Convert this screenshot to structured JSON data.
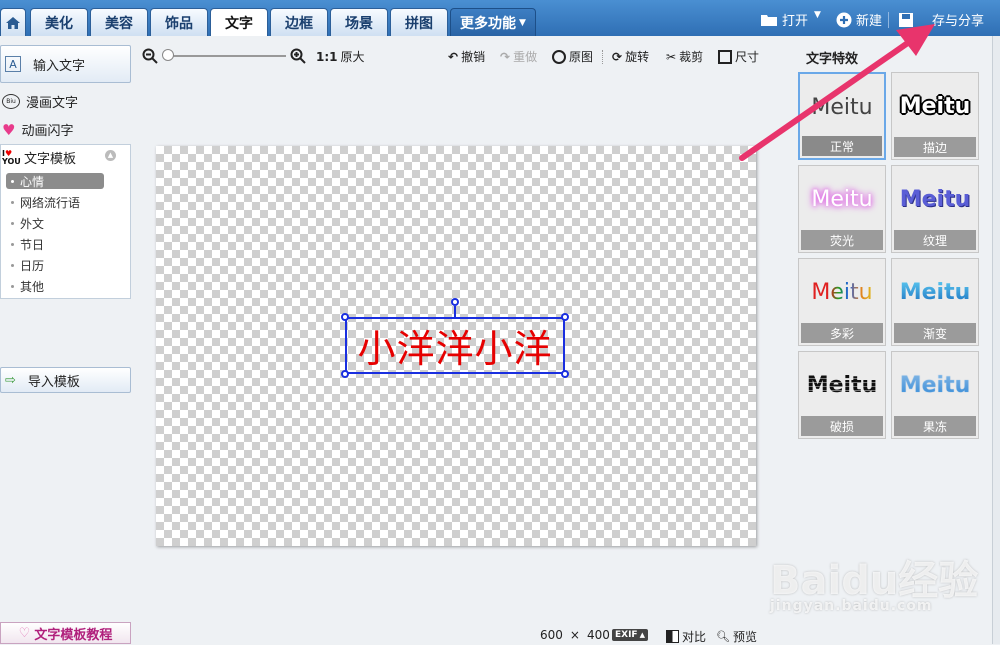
{
  "top_tabs": [
    "美化",
    "美容",
    "饰品",
    "文字",
    "边框",
    "场景",
    "拼图"
  ],
  "active_tab": "文字",
  "more_tab": "更多功能",
  "top_actions": {
    "open": "打开",
    "new": "新建",
    "save_share": "存与分享"
  },
  "left_panel": {
    "input_text": "输入文字",
    "comic_text": "漫画文字",
    "animated_text": "动画闪字",
    "text_template": "文字模板",
    "template_items": [
      "心情",
      "网络流行语",
      "外文",
      "节日",
      "日历",
      "其他"
    ],
    "selected_template": "心情",
    "import_template": "导入模板",
    "tutorial": "文字模板教程"
  },
  "toolbar": {
    "zoom_ratio": "1:1",
    "original_size": "原大",
    "undo": "撤销",
    "redo": "重做",
    "original": "原图",
    "rotate": "旋转",
    "crop": "裁剪",
    "size": "尺寸"
  },
  "canvas": {
    "text": "小洋洋小洋",
    "text_color": "#e60000"
  },
  "effects_panel": {
    "title": "文字特效",
    "sample_text": "Meitu",
    "items": [
      {
        "label": "正常"
      },
      {
        "label": "描边"
      },
      {
        "label": "荧光"
      },
      {
        "label": "纹理"
      },
      {
        "label": "多彩"
      },
      {
        "label": "渐变"
      },
      {
        "label": "破损"
      },
      {
        "label": "果冻"
      }
    ],
    "selected": "正常"
  },
  "status_bar": {
    "width": "600",
    "times": "×",
    "height": "400",
    "exif": "EXIF",
    "compare": "对比",
    "preview": "预览"
  },
  "watermark": {
    "brand": "Baidu经验",
    "url": "jingyan.baidu.com"
  },
  "colors": {
    "accent_blue": "#2f6fb4",
    "arrow": "#e8346c",
    "selection": "#1a2fe0"
  }
}
